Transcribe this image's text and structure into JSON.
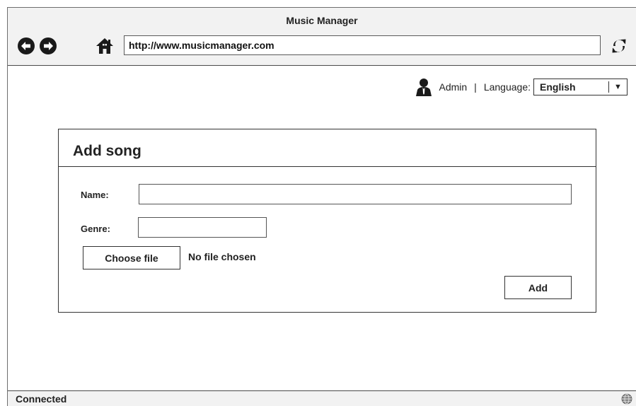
{
  "window": {
    "title": "Music Manager"
  },
  "browser": {
    "url": "http://www.musicmanager.com",
    "back_icon": "back-arrow-icon",
    "forward_icon": "forward-arrow-icon",
    "home_icon": "home-icon",
    "refresh_icon": "refresh-icon"
  },
  "header": {
    "user_icon": "user-icon",
    "user_name": "Admin",
    "separator": "|",
    "language_label": "Language:",
    "language_value": "English"
  },
  "form": {
    "title": "Add song",
    "name_label": "Name:",
    "name_value": "",
    "genre_label": "Genre:",
    "genre_value": "",
    "choose_file_label": "Choose file",
    "file_status": "No file chosen",
    "add_label": "Add"
  },
  "status": {
    "text": "Connected",
    "globe_icon": "globe-icon"
  },
  "colors": {
    "chrome_bg": "#f2f2f2",
    "border": "#333333",
    "icon": "#1a1a1a"
  }
}
